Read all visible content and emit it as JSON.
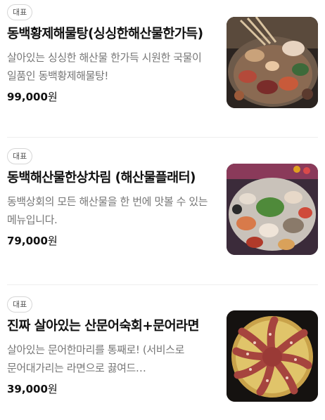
{
  "menu": {
    "items": [
      {
        "badge": "대표",
        "title": "동백황제해물탕(싱싱한해산물한가득)",
        "description": "살아있는 싱싱한 해산물 한가득 시원한 국물이 일품인 동백황제해물탕!",
        "price": "99,000",
        "currency": "원",
        "photo_icon": "seafood-stew-photo"
      },
      {
        "badge": "대표",
        "title": "동백해산물한상차림 (해산물플래터)",
        "description": "동백상회의 모든 해산물을 한 번에 맛볼 수 있는 메뉴입니다.",
        "price": "79,000",
        "currency": "원",
        "photo_icon": "seafood-platter-photo"
      },
      {
        "badge": "대표",
        "title": "진짜 살아있는 산문어숙회+문어라면",
        "description": "살아있는 문어한마리를 통째로! (서비스로 문어대가리는 라면으로 끓여드…",
        "price": "39,000",
        "currency": "원",
        "photo_icon": "octopus-photo"
      }
    ]
  }
}
